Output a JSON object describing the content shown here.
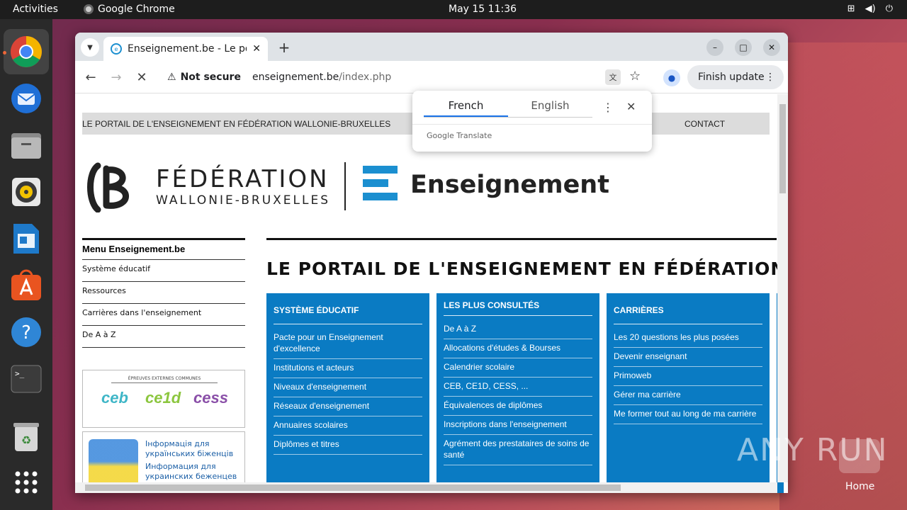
{
  "topbar": {
    "activities": "Activities",
    "app_name": "Google Chrome",
    "clock": "May 15  11:36"
  },
  "dock": {
    "items": [
      "chrome-icon",
      "thunderbird-icon",
      "files-icon",
      "rhythmbox-icon",
      "writer-icon",
      "app-center-icon",
      "help-icon",
      "terminal-icon",
      "trash-icon",
      "app-grid-icon"
    ]
  },
  "browser": {
    "tab_title": "Enseignement.be - Le portail",
    "security_label": "Not secure",
    "url_host": "enseignement.be",
    "url_path": "/index.php",
    "finish_update": "Finish update"
  },
  "translate_popup": {
    "source_lang": "French",
    "target_lang": "English",
    "brand": "Google Translate"
  },
  "site": {
    "header_portal": "LE PORTAIL DE L'ENSEIGNEMENT EN FÉDÉRATION WALLONIE-BRUXELLES",
    "header_contact": "CONTACT",
    "logo_line1": "FÉDÉRATION",
    "logo_line2": "WALLONIE-BRUXELLES",
    "logo_ens": "Enseignement",
    "menu_title": "Menu Enseignement.be",
    "menu_items": [
      "Système éducatif",
      "Ressources",
      "Carrières dans l'enseignement",
      "De A à Z"
    ],
    "promo1_caption": "ÉPREUVES EXTERNES COMMUNES",
    "promo1_badges": [
      "ceb",
      "ce1d",
      "cess"
    ],
    "promo2_lines": [
      "Інформація для",
      "українських біженців",
      "Информация для",
      "украинских беженцев"
    ],
    "main_title": "LE PORTAIL DE L'ENSEIGNEMENT EN FÉDÉRATION WALLONIE-BRUXELLES",
    "columns": [
      {
        "heading": "SYSTÈME ÉDUCATIF",
        "items": [
          "Pacte pour un Enseignement d'excellence",
          "Institutions et acteurs",
          "Niveaux d'enseignement",
          "Réseaux d'enseignement",
          "Annuaires scolaires",
          "Diplômes et titres"
        ]
      },
      {
        "heading": "LES PLUS CONSULTÉS",
        "items": [
          "De A à Z",
          "Allocations d'études & Bourses",
          "Calendrier scolaire",
          "CEB, CE1D, CESS, ...",
          "Équivalences de diplômes",
          "Inscriptions dans l'enseignement",
          "Agrément des prestataires de soins de santé"
        ]
      },
      {
        "heading": "CARRIÈRES",
        "items": [
          "Les 20 questions les plus posées",
          "Devenir enseignant",
          "Primoweb",
          "Gérer ma carrière",
          "Me former tout au long de ma carrière"
        ]
      }
    ]
  },
  "desktop": {
    "watermark": "ANY RUN",
    "home_label": "Home"
  },
  "colors": {
    "accent_blue": "#0a7bc3",
    "ubuntu_orange": "#e95420"
  }
}
